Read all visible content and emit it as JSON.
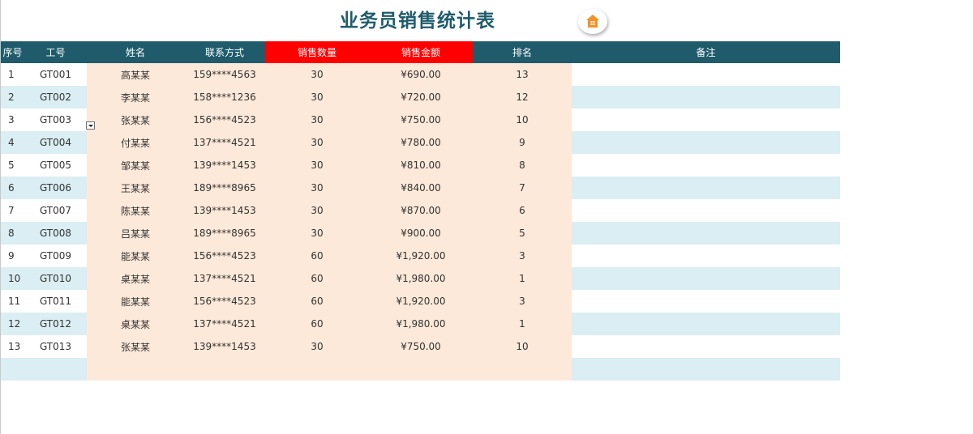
{
  "title": "业务员销售统计表",
  "home_button_icon": "home-icon",
  "colors": {
    "header_bg": "#1f5b6b",
    "header_highlight": "#ff0000",
    "band_blue": "#daeef3",
    "peach": "#fde9d9",
    "title_color": "#1f5b6b",
    "home_icon": "#f0932b"
  },
  "headers": {
    "seq": "序号",
    "id": "工号",
    "name": "姓名",
    "contact": "联系方式",
    "qty": "销售数量",
    "amount": "销售金额",
    "rank": "排名",
    "note": "备注"
  },
  "rows": [
    {
      "seq": "1",
      "id": "GT001",
      "name": "高某某",
      "contact": "159****4563",
      "qty": "30",
      "amount": "¥690.00",
      "rank": "13",
      "note": ""
    },
    {
      "seq": "2",
      "id": "GT002",
      "name": "李某某",
      "contact": "158****1236",
      "qty": "30",
      "amount": "¥720.00",
      "rank": "12",
      "note": ""
    },
    {
      "seq": "3",
      "id": "GT003",
      "name": "张某某",
      "contact": "156****4523",
      "qty": "30",
      "amount": "¥750.00",
      "rank": "10",
      "note": ""
    },
    {
      "seq": "4",
      "id": "GT004",
      "name": "付某某",
      "contact": "137****4521",
      "qty": "30",
      "amount": "¥780.00",
      "rank": "9",
      "note": ""
    },
    {
      "seq": "5",
      "id": "GT005",
      "name": "邹某某",
      "contact": "139****1453",
      "qty": "30",
      "amount": "¥810.00",
      "rank": "8",
      "note": ""
    },
    {
      "seq": "6",
      "id": "GT006",
      "name": "王某某",
      "contact": "189****8965",
      "qty": "30",
      "amount": "¥840.00",
      "rank": "7",
      "note": ""
    },
    {
      "seq": "7",
      "id": "GT007",
      "name": "陈某某",
      "contact": "139****1453",
      "qty": "30",
      "amount": "¥870.00",
      "rank": "6",
      "note": ""
    },
    {
      "seq": "8",
      "id": "GT008",
      "name": "吕某某",
      "contact": "189****8965",
      "qty": "30",
      "amount": "¥900.00",
      "rank": "5",
      "note": ""
    },
    {
      "seq": "9",
      "id": "GT009",
      "name": "能某某",
      "contact": "156****4523",
      "qty": "60",
      "amount": "¥1,920.00",
      "rank": "3",
      "note": ""
    },
    {
      "seq": "10",
      "id": "GT010",
      "name": "桌某某",
      "contact": "137****4521",
      "qty": "60",
      "amount": "¥1,980.00",
      "rank": "1",
      "note": ""
    },
    {
      "seq": "11",
      "id": "GT011",
      "name": "能某某",
      "contact": "156****4523",
      "qty": "60",
      "amount": "¥1,920.00",
      "rank": "3",
      "note": ""
    },
    {
      "seq": "12",
      "id": "GT012",
      "name": "桌某某",
      "contact": "137****4521",
      "qty": "60",
      "amount": "¥1,980.00",
      "rank": "1",
      "note": ""
    },
    {
      "seq": "13",
      "id": "GT013",
      "name": "张某某",
      "contact": "139****1453",
      "qty": "30",
      "amount": "¥750.00",
      "rank": "10",
      "note": ""
    },
    {
      "seq": "",
      "id": "",
      "name": "",
      "contact": "",
      "qty": "",
      "amount": "",
      "rank": "",
      "note": ""
    }
  ]
}
